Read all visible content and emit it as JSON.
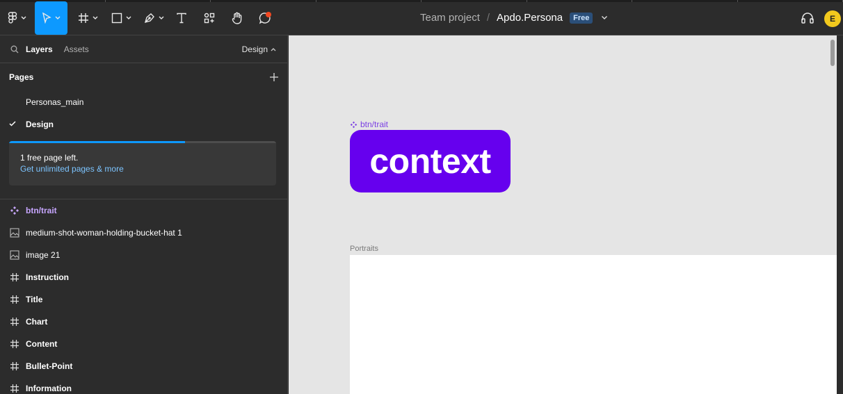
{
  "toolbar": {
    "project_team": "Team project",
    "separator": "/",
    "file_name": "Apdo.Persona",
    "plan_badge": "Free",
    "avatar_initial": "E",
    "tools": [
      "main-menu",
      "move",
      "frame",
      "shape",
      "pen",
      "text",
      "resources",
      "hand",
      "comment"
    ]
  },
  "left_panel": {
    "tab_layers": "Layers",
    "tab_assets": "Assets",
    "tab_design": "Design",
    "pages_heading": "Pages",
    "pages": [
      {
        "name": "Personas_main",
        "current": false
      },
      {
        "name": "Design",
        "current": true
      }
    ],
    "upsell": {
      "message": "1 free page left.",
      "link": "Get unlimited pages & more",
      "progress": 0.66
    },
    "layers": [
      {
        "name": "btn/trait",
        "kind": "component"
      },
      {
        "name": "medium-shot-woman-holding-bucket-hat 1",
        "kind": "image"
      },
      {
        "name": "image 21",
        "kind": "image"
      },
      {
        "name": "Instruction",
        "kind": "frame"
      },
      {
        "name": "Title",
        "kind": "frame"
      },
      {
        "name": "Chart",
        "kind": "frame"
      },
      {
        "name": "Content",
        "kind": "frame"
      },
      {
        "name": "Bullet-Point",
        "kind": "frame"
      },
      {
        "name": "Information",
        "kind": "frame"
      }
    ]
  },
  "canvas": {
    "component_label": "btn/trait",
    "component_text": "context",
    "frame_label": "Portraits",
    "colors": {
      "background": "#e5e5e5",
      "component_fill": "#6600ee",
      "component_label": "#7b3fe4"
    }
  }
}
